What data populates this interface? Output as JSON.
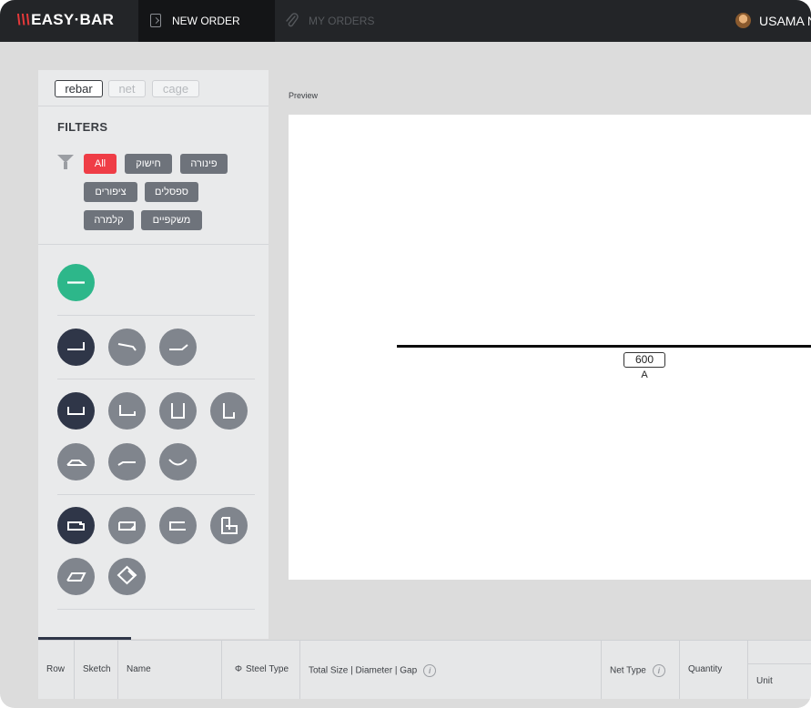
{
  "topbar": {
    "logo_mark": "\\\\\\",
    "logo_text": "EASY·BAR",
    "nav_new_order": "NEW ORDER",
    "nav_my_orders": "MY ORDERS",
    "user_name": "USAMA N"
  },
  "sidebar": {
    "type_tabs": [
      "rebar",
      "net",
      "cage"
    ],
    "active_type": "rebar",
    "filters_title": "FILTERS",
    "filter_chips": [
      "All",
      "חישוק",
      "פינורה",
      "ציפורים",
      "ספסלים",
      "קלמרה",
      "משקפיים"
    ],
    "active_filter": "All"
  },
  "shapes": [
    "straight-bar-shape",
    "l-hook-shape",
    "bent-end-shape",
    "angled-end-shape",
    "u-shape",
    "l-shape",
    "tall-u-shape",
    "tall-l-shape",
    "trapezoid-shape",
    "offset-bend-shape",
    "curve-shape",
    "closed-stirrup-shape",
    "hooked-rect-shape",
    "open-rect-shape",
    "double-stirrup-shape",
    "parallelogram-shape",
    "diamond-shape"
  ],
  "preview": {
    "label": "Preview",
    "dimension_value": "600",
    "dimension_letter": "A"
  },
  "table": {
    "columns": [
      "Row",
      "Sketch",
      "Name",
      "Steel Type",
      "Total Size | Diameter | Gap",
      "Net Type",
      "Quantity",
      "",
      "Unit"
    ]
  },
  "colors": {
    "accent_red": "#ef3d46",
    "active_green": "#2db78a",
    "dark_navy": "#2f3648",
    "chip_gray": "#6e737b"
  }
}
